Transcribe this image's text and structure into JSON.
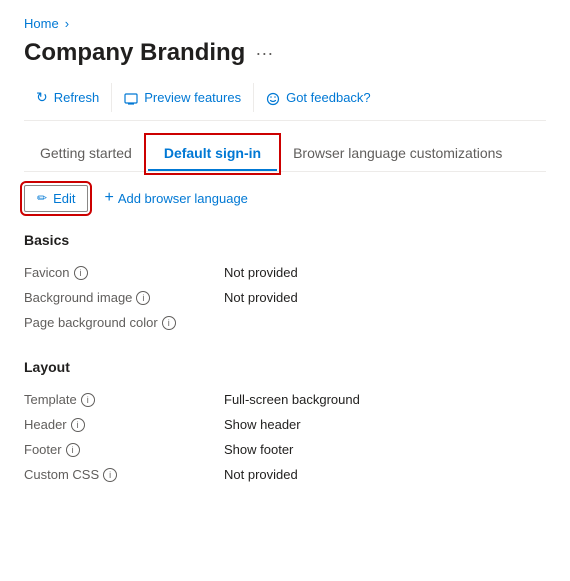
{
  "breadcrumb": {
    "home_label": "Home",
    "separator": "›"
  },
  "page": {
    "title": "Company Branding",
    "ellipsis": "···"
  },
  "toolbar": {
    "buttons": [
      {
        "id": "refresh",
        "label": "Refresh",
        "icon": "↻"
      },
      {
        "id": "preview",
        "label": "Preview features",
        "icon": "🖥"
      },
      {
        "id": "feedback",
        "label": "Got feedback?",
        "icon": "💬"
      }
    ]
  },
  "tabs": [
    {
      "id": "getting-started",
      "label": "Getting started",
      "active": false
    },
    {
      "id": "default-sign-in",
      "label": "Default sign-in",
      "active": true
    },
    {
      "id": "browser-language",
      "label": "Browser language customizations",
      "active": false
    }
  ],
  "action_bar": {
    "edit_label": "Edit",
    "edit_icon": "✏",
    "add_label": "Add browser language",
    "add_icon": "+"
  },
  "sections": [
    {
      "id": "basics",
      "title": "Basics",
      "properties": [
        {
          "label": "Favicon",
          "value": "Not provided",
          "has_info": true
        },
        {
          "label": "Background image",
          "value": "Not provided",
          "has_info": true
        },
        {
          "label": "Page background color",
          "value": "",
          "has_info": true
        }
      ]
    },
    {
      "id": "layout",
      "title": "Layout",
      "properties": [
        {
          "label": "Template",
          "value": "Full-screen background",
          "has_info": true
        },
        {
          "label": "Header",
          "value": "Show header",
          "has_info": true
        },
        {
          "label": "Footer",
          "value": "Show footer",
          "has_info": true
        },
        {
          "label": "Custom CSS",
          "value": "Not provided",
          "has_info": true
        }
      ]
    }
  ]
}
